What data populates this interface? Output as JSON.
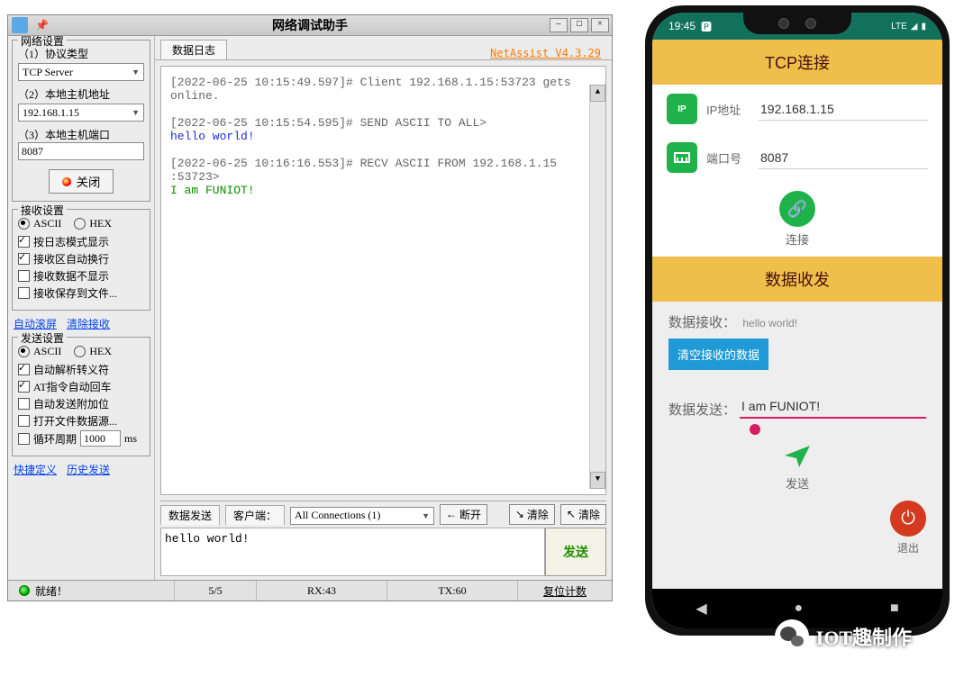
{
  "window": {
    "title": "网络调试助手",
    "brand": "NetAssist V4.3.29"
  },
  "network": {
    "group_label": "网络设置",
    "protocol_label": "（1）协议类型",
    "protocol_value": "TCP Server",
    "host_label": "（2）本地主机地址",
    "host_value": "192.168.1.15",
    "port_label": "（3）本地主机端口",
    "port_value": "8087",
    "close_btn": "关闭"
  },
  "recv": {
    "group_label": "接收设置",
    "ascii": "ASCII",
    "hex": "HEX",
    "opt_log": "按日志模式显示",
    "opt_wrap": "接收区自动换行",
    "opt_hide": "接收数据不显示",
    "opt_save": "接收保存到文件...",
    "auto_scroll": "自动滚屏",
    "clear_recv": "清除接收"
  },
  "send": {
    "group_label": "发送设置",
    "ascii": "ASCII",
    "hex": "HEX",
    "opt_escape": "自动解析转义符",
    "opt_at": "AT指令自动回车",
    "opt_append": "自动发送附加位",
    "opt_file": "打开文件数据源...",
    "opt_loop": "循环周期",
    "loop_val": "1000",
    "loop_unit": "ms",
    "quick_def": "快捷定义",
    "history": "历史发送"
  },
  "log": {
    "tab": "数据日志",
    "l1": "[2022-06-25 10:15:49.597]# Client 192.168.1.15:53723 gets online.",
    "l2a": "[2022-06-25 10:15:54.595]# SEND ASCII TO ALL>",
    "l2b": "hello world!",
    "l3a": "[2022-06-25 10:16:16.553]# RECV ASCII FROM 192.168.1.15 :53723>",
    "l3b": "I am FUNIOT!"
  },
  "sendbar": {
    "tab_send": "数据发送",
    "tab_client": "客户端：",
    "connections": "All Connections (1)",
    "disconnect": "断开",
    "clear1": "清除",
    "clear2": "清除",
    "textarea": "hello world!",
    "send_btn": "发送"
  },
  "status": {
    "ready": "就绪！",
    "count": "5/5",
    "rx": "RX:43",
    "tx": "TX:60",
    "reset": "复位计数"
  },
  "phone": {
    "time": "19:45",
    "lte": "LTE",
    "tcp_header": "TCP连接",
    "ip_label": "IP地址",
    "ip_value": "192.168.1.15",
    "port_label": "端口号",
    "port_value": "8087",
    "connect": "连接",
    "data_header": "数据收发",
    "recv_label": "数据接收：",
    "recv_value": "hello world!",
    "clear_btn": "清空接收的数据",
    "send_label": "数据发送：",
    "send_value": "I am FUNIOT!",
    "send_btn": "发送",
    "exit": "退出"
  },
  "footer": {
    "brand": "IOT趣制作"
  }
}
